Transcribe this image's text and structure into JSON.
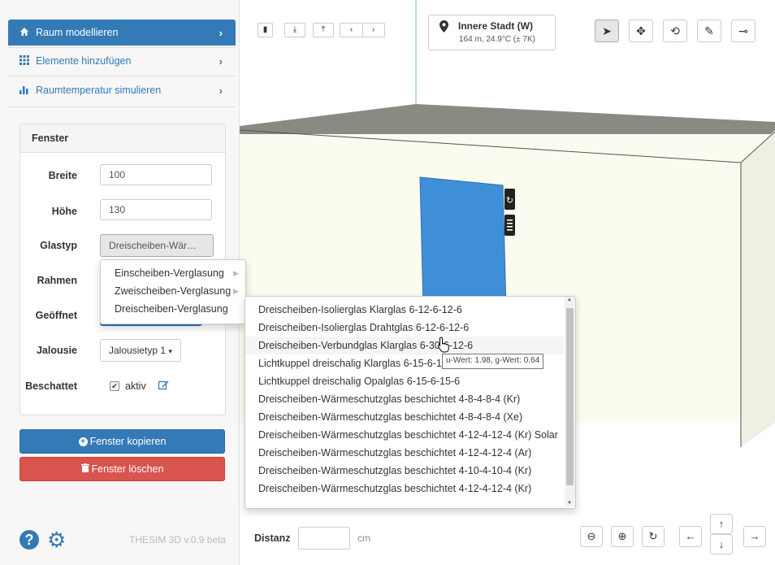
{
  "sidebar": {
    "nav": [
      {
        "label": "Raum modellieren",
        "icon": "home-icon"
      },
      {
        "label": "Elemente hinzufügen",
        "icon": "grid-icon"
      },
      {
        "label": "Raumtemperatur simulieren",
        "icon": "bar-chart-icon"
      }
    ],
    "panel_title": "Fenster",
    "fields": {
      "breite_label": "Breite",
      "breite_value": "100",
      "hoehe_label": "Höhe",
      "hoehe_value": "130",
      "glastyp_label": "Glastyp",
      "glastyp_value": "Dreischeiben-Wär…",
      "rahmen_label": "Rahmen",
      "geoeffnet_label": "Geöffnet",
      "jalousie_label": "Jalousie",
      "jalousie_value": "Jalousietyp 1",
      "beschattet_label": "Beschattet",
      "beschattet_checkbox": "aktiv"
    },
    "copy_button": "Fenster kopieren",
    "delete_button": "Fenster löschen",
    "version": "THESIM 3D v.0.9 beta"
  },
  "location": {
    "name": "Innere Stadt (W)",
    "details": "164 m, 24.9°C (± 7K)"
  },
  "glass_categories": [
    "Einscheiben-Verglasung",
    "Zweischeiben-Verglasung",
    "Dreischeiben-Verglasung"
  ],
  "glass_options": [
    "Dreischeiben-Isolierglas Klarglas 6-12-6-12-6",
    "Dreischeiben-Isolierglas Drahtglas 6-12-6-12-6",
    "Dreischeiben-Verbundglas Klarglas 6-30-6-12-6",
    "Lichtkuppel dreischalig Klarglas 6-15-6-15-6",
    "Lichtkuppel dreischalig Opalglas 6-15-6-15-6",
    "Dreischeiben-Wärmeschutzglas beschichtet 4-8-4-8-4 (Kr)",
    "Dreischeiben-Wärmeschutzglas beschichtet 4-8-4-8-4 (Xe)",
    "Dreischeiben-Wärmeschutzglas beschichtet 4-12-4-12-4 (Kr) Solar",
    "Dreischeiben-Wärmeschutzglas beschichtet 4-12-4-12-4 (Ar)",
    "Dreischeiben-Wärmeschutzglas beschichtet 4-10-4-10-4 (Kr)",
    "Dreischeiben-Wärmeschutzglas beschichtet 4-12-4-12-4 (Kr)"
  ],
  "tooltip": "u-Wert: 1.98, g-Wert: 0.64",
  "distance": {
    "label": "Distanz",
    "value": "",
    "unit": "cm"
  },
  "colors": {
    "primary": "#337ab7",
    "danger": "#d9534f",
    "window": "#3f8fd8"
  }
}
